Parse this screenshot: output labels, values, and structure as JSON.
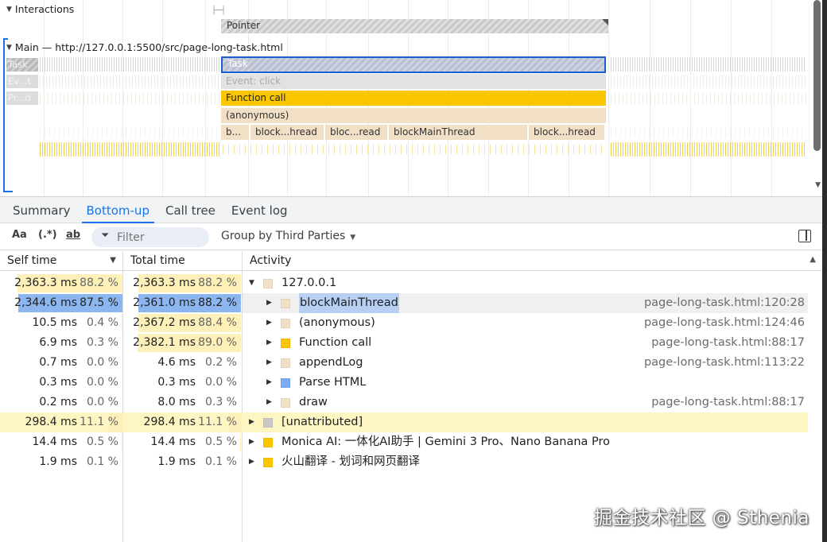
{
  "timeline": {
    "interactions_label": "Interactions",
    "pointer_label": "Pointer",
    "main_label": "Main — http://127.0.0.1:5500/src/page-long-task.html",
    "side_chips": [
      "Task",
      "Ev...t",
      "Pr...d"
    ],
    "flame": {
      "task": "Task",
      "event": "Event: click",
      "function": "Function call",
      "anon": "(anonymous)",
      "subcalls": [
        "b...",
        "block...hread",
        "bloc...read",
        "blockMainThread",
        "block...hread"
      ]
    }
  },
  "tabs": [
    {
      "label": "Summary",
      "active": false
    },
    {
      "label": "Bottom-up",
      "active": true
    },
    {
      "label": "Call tree",
      "active": false
    },
    {
      "label": "Event log",
      "active": false
    }
  ],
  "toolbar": {
    "match_case": "Aa",
    "regex": "(.*)",
    "whole_word": "ab",
    "filter_placeholder": "Filter",
    "group_by": "Group by Third Parties"
  },
  "columns": {
    "self_time": "Self time",
    "total_time": "Total time",
    "activity": "Activity"
  },
  "rows": [
    {
      "self_ms": "2,363.3 ms",
      "self_pct": "88.2 %",
      "total_ms": "2,363.3 ms",
      "total_pct": "88.2 %",
      "depth": 0,
      "expanded": true,
      "color": "#f1dfc6",
      "name": "127.0.0.1",
      "url": "",
      "self_frac": 0.882,
      "total_frac": 0.882,
      "state": "normal"
    },
    {
      "self_ms": "2,344.6 ms",
      "self_pct": "87.5 %",
      "total_ms": "2,361.0 ms",
      "total_pct": "88.2 %",
      "depth": 1,
      "expanded": false,
      "color": "#f1dfc6",
      "name": "blockMainThread",
      "url": "page-long-task.html:120:28",
      "self_frac": 0.875,
      "total_frac": 0.882,
      "state": "selected"
    },
    {
      "self_ms": "10.5 ms",
      "self_pct": "0.4 %",
      "total_ms": "2,367.2 ms",
      "total_pct": "88.4 %",
      "depth": 1,
      "expanded": false,
      "color": "#f1dfc6",
      "name": "(anonymous)",
      "url": "page-long-task.html:124:46",
      "self_frac": 0.004,
      "total_frac": 0.884,
      "state": "normal"
    },
    {
      "self_ms": "6.9 ms",
      "self_pct": "0.3 %",
      "total_ms": "2,382.1 ms",
      "total_pct": "89.0 %",
      "depth": 1,
      "expanded": false,
      "color": "#f9c600",
      "name": "Function call",
      "url": "page-long-task.html:88:17",
      "self_frac": 0.003,
      "total_frac": 0.89,
      "state": "normal"
    },
    {
      "self_ms": "0.7 ms",
      "self_pct": "0.0 %",
      "total_ms": "4.6 ms",
      "total_pct": "0.2 %",
      "depth": 1,
      "expanded": false,
      "color": "#f1dfc6",
      "name": "appendLog",
      "url": "page-long-task.html:113:22",
      "self_frac": 0.0,
      "total_frac": 0.002,
      "state": "normal"
    },
    {
      "self_ms": "0.3 ms",
      "self_pct": "0.0 %",
      "total_ms": "0.3 ms",
      "total_pct": "0.0 %",
      "depth": 1,
      "expanded": false,
      "color": "#7baaf7",
      "name": "Parse HTML",
      "url": "",
      "self_frac": 0.0,
      "total_frac": 0.0,
      "state": "normal"
    },
    {
      "self_ms": "0.2 ms",
      "self_pct": "0.0 %",
      "total_ms": "8.0 ms",
      "total_pct": "0.3 %",
      "depth": 1,
      "expanded": false,
      "color": "#f1dfc6",
      "name": "draw",
      "url": "page-long-task.html:88:17",
      "self_frac": 0.0,
      "total_frac": 0.003,
      "state": "normal"
    },
    {
      "self_ms": "298.4 ms",
      "self_pct": "11.1 %",
      "total_ms": "298.4 ms",
      "total_pct": "11.1 %",
      "depth": 0,
      "expanded": false,
      "color": "#c8c8c8",
      "name": "[unattributed]",
      "url": "",
      "self_frac": 0.111,
      "total_frac": 0.111,
      "state": "highlight"
    },
    {
      "self_ms": "14.4 ms",
      "self_pct": "0.5 %",
      "total_ms": "14.4 ms",
      "total_pct": "0.5 %",
      "depth": 0,
      "expanded": false,
      "color": "#f9c600",
      "name": "Monica AI: 一体化AI助手 | Gemini 3 Pro、Nano Banana Pro",
      "url": "",
      "self_frac": 0.005,
      "total_frac": 0.005,
      "state": "normal"
    },
    {
      "self_ms": "1.9 ms",
      "self_pct": "0.1 %",
      "total_ms": "1.9 ms",
      "total_pct": "0.1 %",
      "depth": 0,
      "expanded": false,
      "color": "#f9c600",
      "name": "火山翻译 - 划词和网页翻译",
      "url": "",
      "self_frac": 0.001,
      "total_frac": 0.001,
      "state": "normal"
    }
  ],
  "watermark": "掘金技术社区 @ Sthenia"
}
